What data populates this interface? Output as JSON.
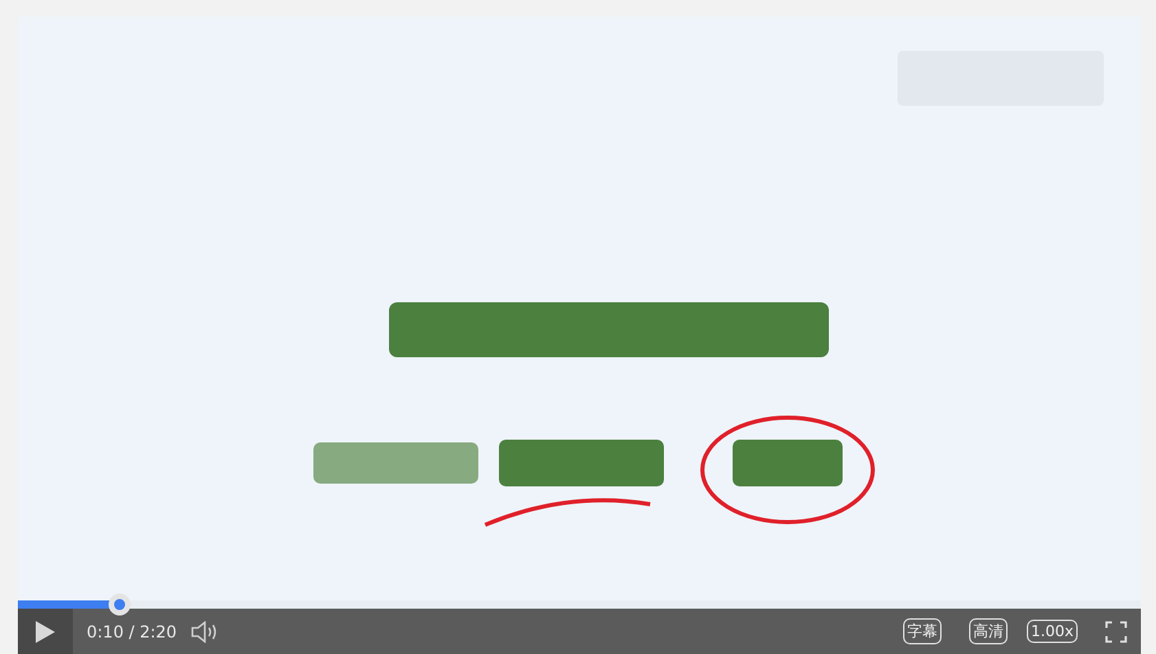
{
  "player": {
    "progress": {
      "level": 0.09
    },
    "time": "0:10 / 2:20",
    "buttons": [
      {
        "label": "字幕"
      },
      {
        "label": "高清"
      },
      {
        "label": "1.00x"
      }
    ]
  }
}
